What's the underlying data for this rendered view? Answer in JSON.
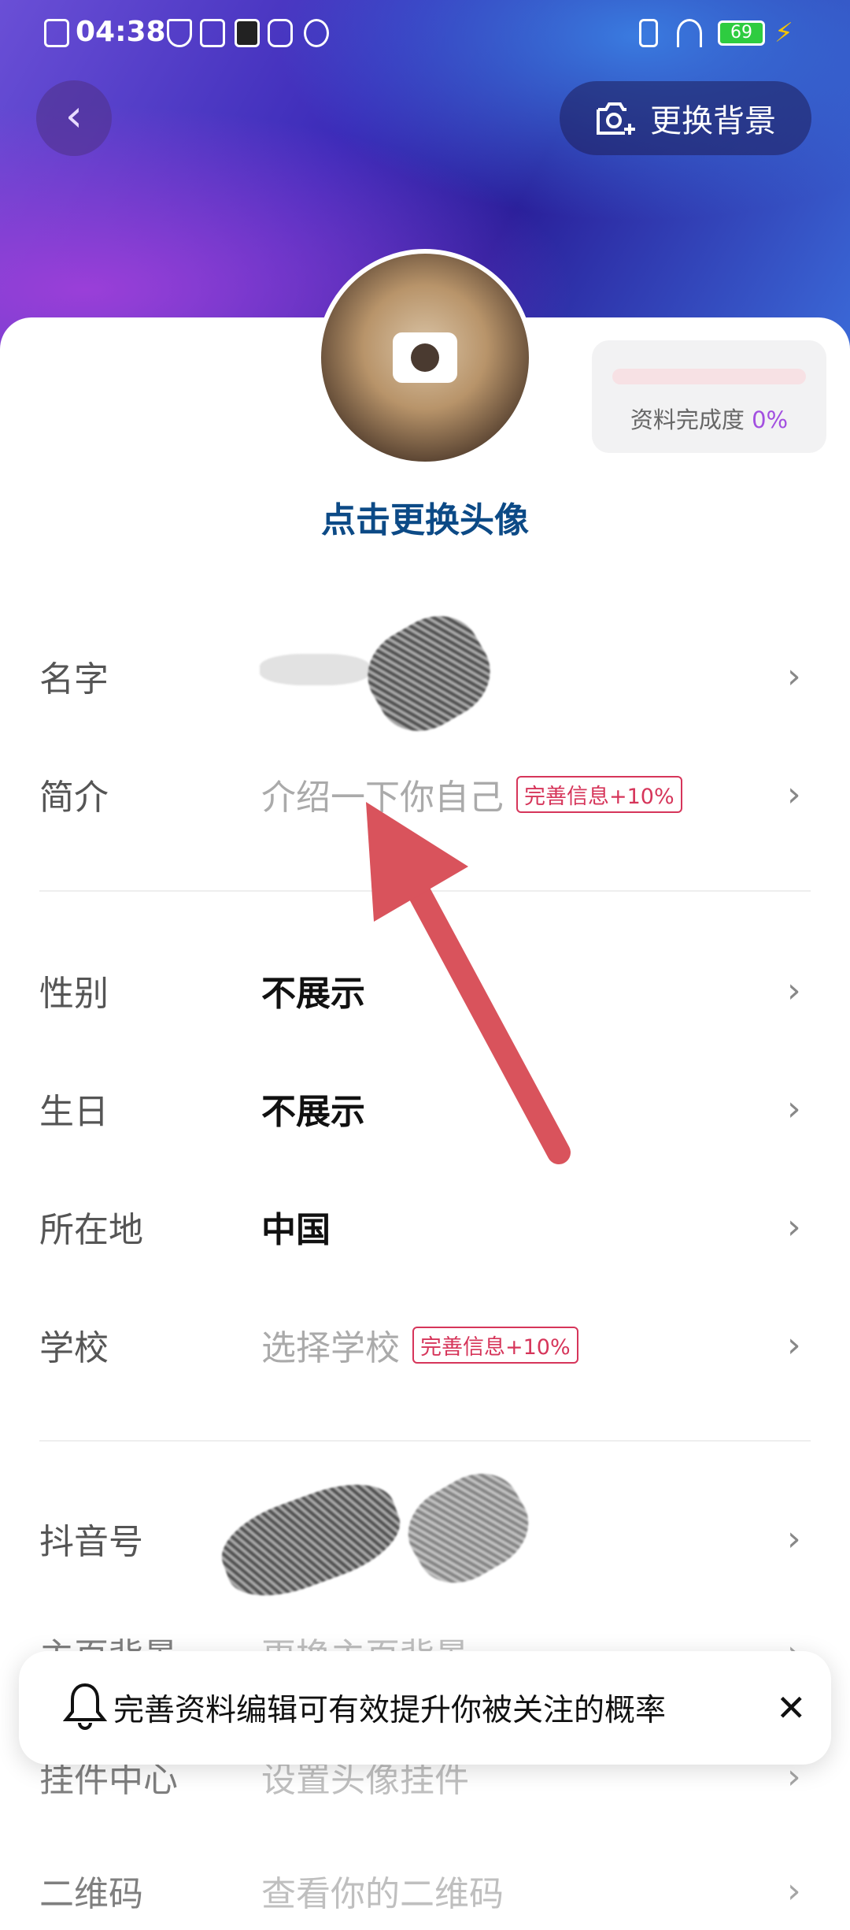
{
  "status_bar": {
    "time": "04:38",
    "battery": "69"
  },
  "header": {
    "back_icon": "chevron-left-icon",
    "change_background": "更换背景"
  },
  "avatar": {
    "change_label": "点击更换头像"
  },
  "completeness": {
    "label": "资料完成度",
    "value": "0%",
    "progress_percent": 0
  },
  "rows": [
    {
      "label": "名字",
      "value": "",
      "style": "bold"
    },
    {
      "label": "简介",
      "value": "介绍一下你自己",
      "tag": "完善信息+10%"
    },
    {
      "label": "性别",
      "value": "不展示"
    },
    {
      "label": "生日",
      "value": "不展示"
    },
    {
      "label": "所在地",
      "value": "中国"
    },
    {
      "label": "学校",
      "value": "选择学校",
      "tag": "完善信息+10%"
    },
    {
      "label": "抖音号",
      "value": ""
    },
    {
      "label": "主页背景",
      "value": "更换主页背景"
    },
    {
      "label": "挂件中心",
      "value": "设置头像挂件"
    },
    {
      "label": "二维码",
      "value": "查看你的二维码"
    }
  ],
  "toast": {
    "icon": "bell-icon",
    "text": "完善资料编辑可有效提升你被关注的概率",
    "close_icon": "close-icon"
  },
  "colors": {
    "accent_blue": "#0c4a86",
    "tag_red": "#d6355a",
    "completeness_purple": "#a24fe0",
    "arrow_red": "#d9535c"
  }
}
